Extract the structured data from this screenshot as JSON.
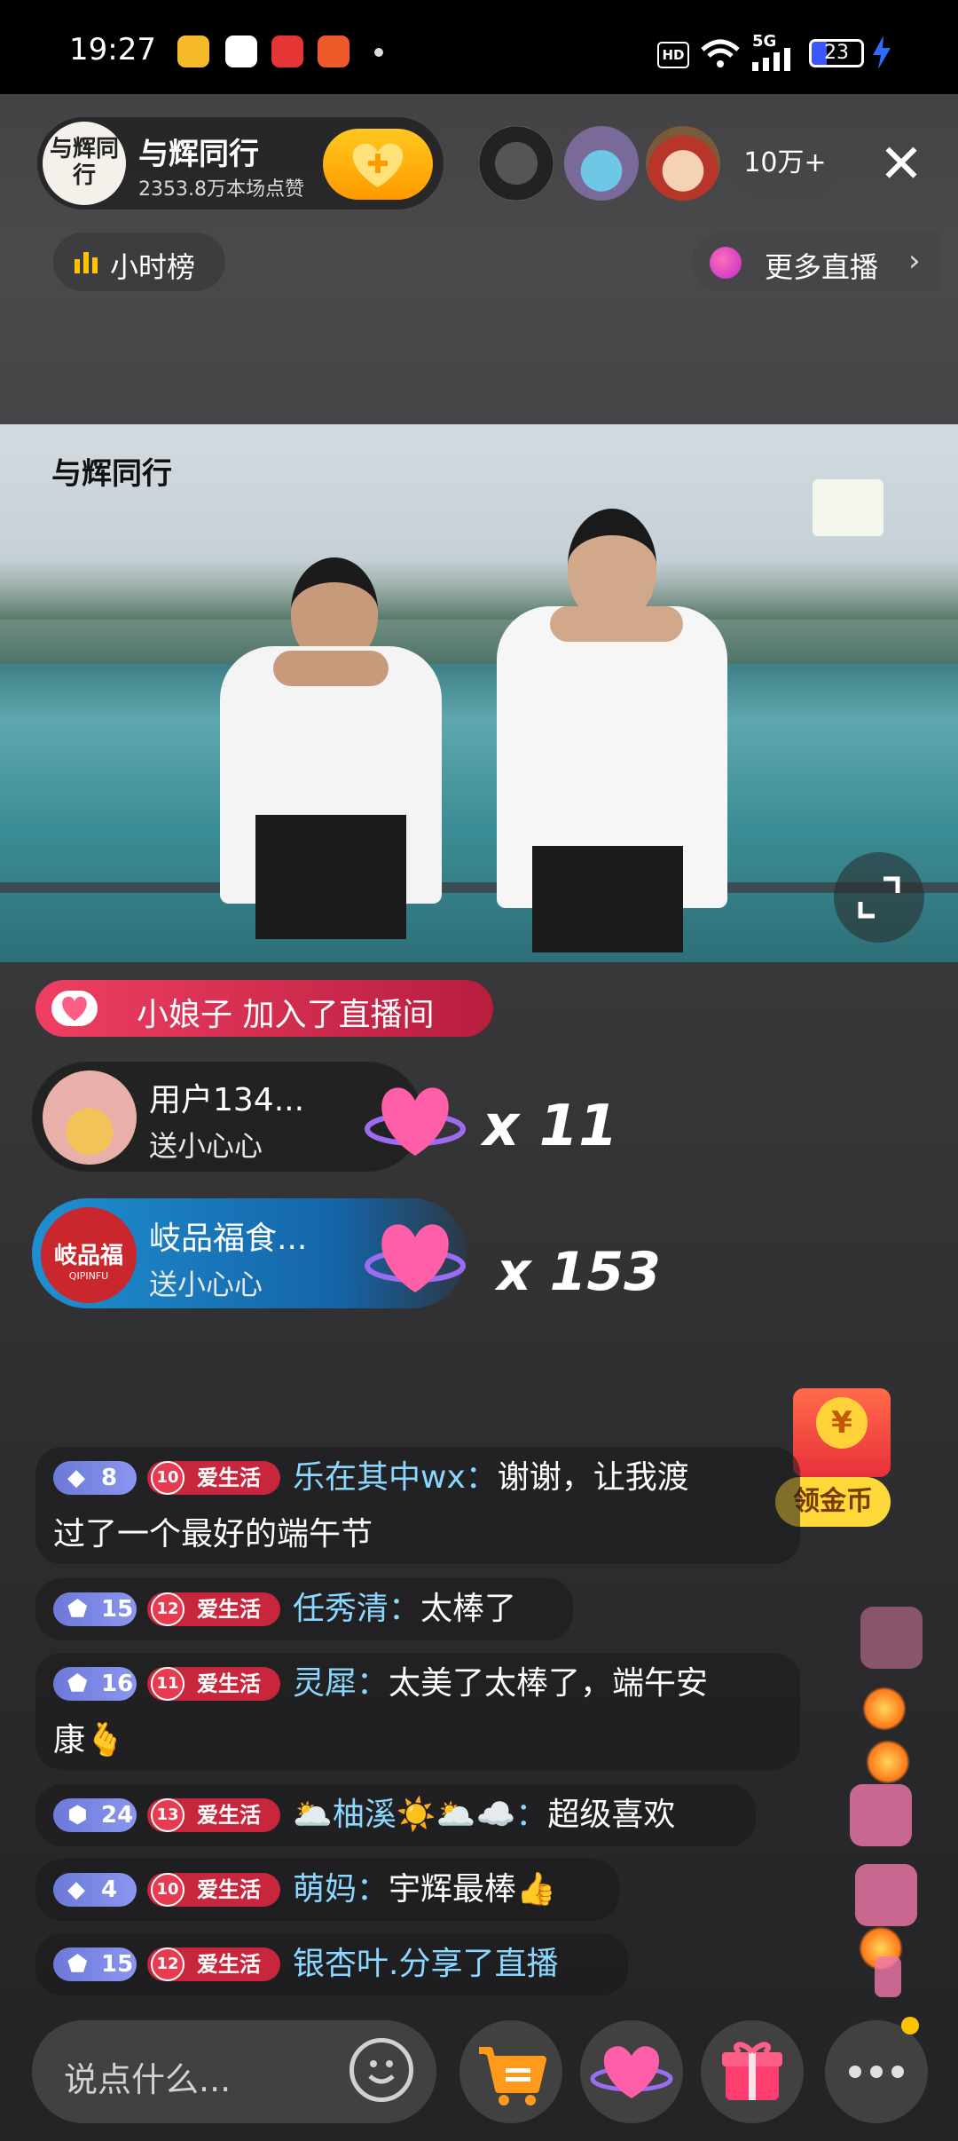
{
  "status_bar": {
    "time": "19:27",
    "hd": "HD",
    "network": "5G",
    "battery": "23"
  },
  "anchor": {
    "name": "与辉同行",
    "likes": "2353.8万本场点赞",
    "avatar_text": "与辉同行"
  },
  "viewers": {
    "count": "10万+"
  },
  "rank": {
    "label": "小时榜"
  },
  "more_live": {
    "label": "更多直播"
  },
  "video": {
    "logo_text": "与辉同行"
  },
  "join_notice": {
    "user": "小娘子",
    "text": "加入了直播间"
  },
  "gifts": [
    {
      "user": "用户134...",
      "gift": "送小心心",
      "count": "x 11"
    },
    {
      "user": "岐品福食...",
      "gift": "送小心心",
      "count": "x 153",
      "avatar_text": "岐品福",
      "avatar_sub": "QIPINFU"
    }
  ],
  "coin": {
    "label": "领金币"
  },
  "chat": [
    {
      "level": "8",
      "tag_level": "10",
      "tag": "爱生活",
      "user": "乐在其中wx：",
      "text_line1": "谢谢，让我渡",
      "text_line2": "过了一个最好的端午节"
    },
    {
      "level": "15",
      "tag_level": "12",
      "tag": "爱生活",
      "user": "任秀清：",
      "text": "太棒了"
    },
    {
      "level": "16",
      "tag_level": "11",
      "tag": "爱生活",
      "user": "灵犀：",
      "text_line1": "太美了太棒了，端午安",
      "text_line2": "康🫰"
    },
    {
      "level": "24",
      "tag_level": "13",
      "tag": "爱生活",
      "user": "🌥️柚溪☀️🌥️☁️：",
      "text": "超级喜欢"
    },
    {
      "level": "4",
      "tag_level": "10",
      "tag": "爱生活",
      "user": "萌妈：",
      "text": "宇辉最棒👍"
    },
    {
      "level": "15",
      "tag_level": "12",
      "tag": "爱生活",
      "user": "银杏叶.",
      "text": "分享了直播"
    }
  ],
  "bottom": {
    "input_placeholder": "说点什么..."
  },
  "colors": {
    "accent_gold": "#ff9a00",
    "join_red": "#ee3f63",
    "username_blue": "#8ad8ff",
    "level_purple": "#6c79d8"
  }
}
